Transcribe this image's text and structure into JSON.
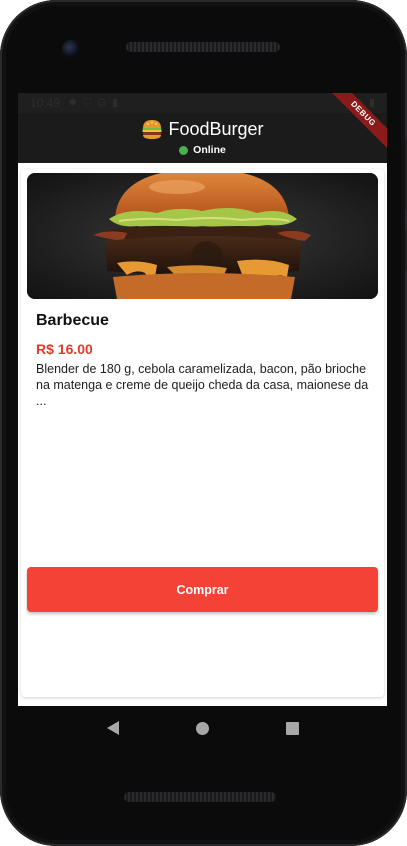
{
  "status_bar": {
    "time": "10:49",
    "icons": [
      "settings-icon",
      "shield-icon",
      "google-icon",
      "clipboard-icon"
    ],
    "right_icons": [
      "wifi-icon",
      "battery-icon"
    ]
  },
  "debug_banner": "DEBUG",
  "app_bar": {
    "title": "FoodBurger",
    "logo_icon": "burger-icon",
    "status_text": "Online",
    "status_color": "#4caf50"
  },
  "product": {
    "name": "Barbecue",
    "price": "R$ 16.00",
    "description": "Blender de 180 g, cebola caramelizada, bacon, pão brioche na matenga e creme de queijo cheda da casa, maionese da ..."
  },
  "buy_button": {
    "label": "Comprar",
    "color": "#f44336"
  },
  "nav_bar": {
    "icons": [
      "back-icon",
      "home-icon",
      "recents-icon"
    ]
  },
  "colors": {
    "accent": "#f44336",
    "price": "#e53a2b",
    "app_bar": "#1b1b1c"
  }
}
